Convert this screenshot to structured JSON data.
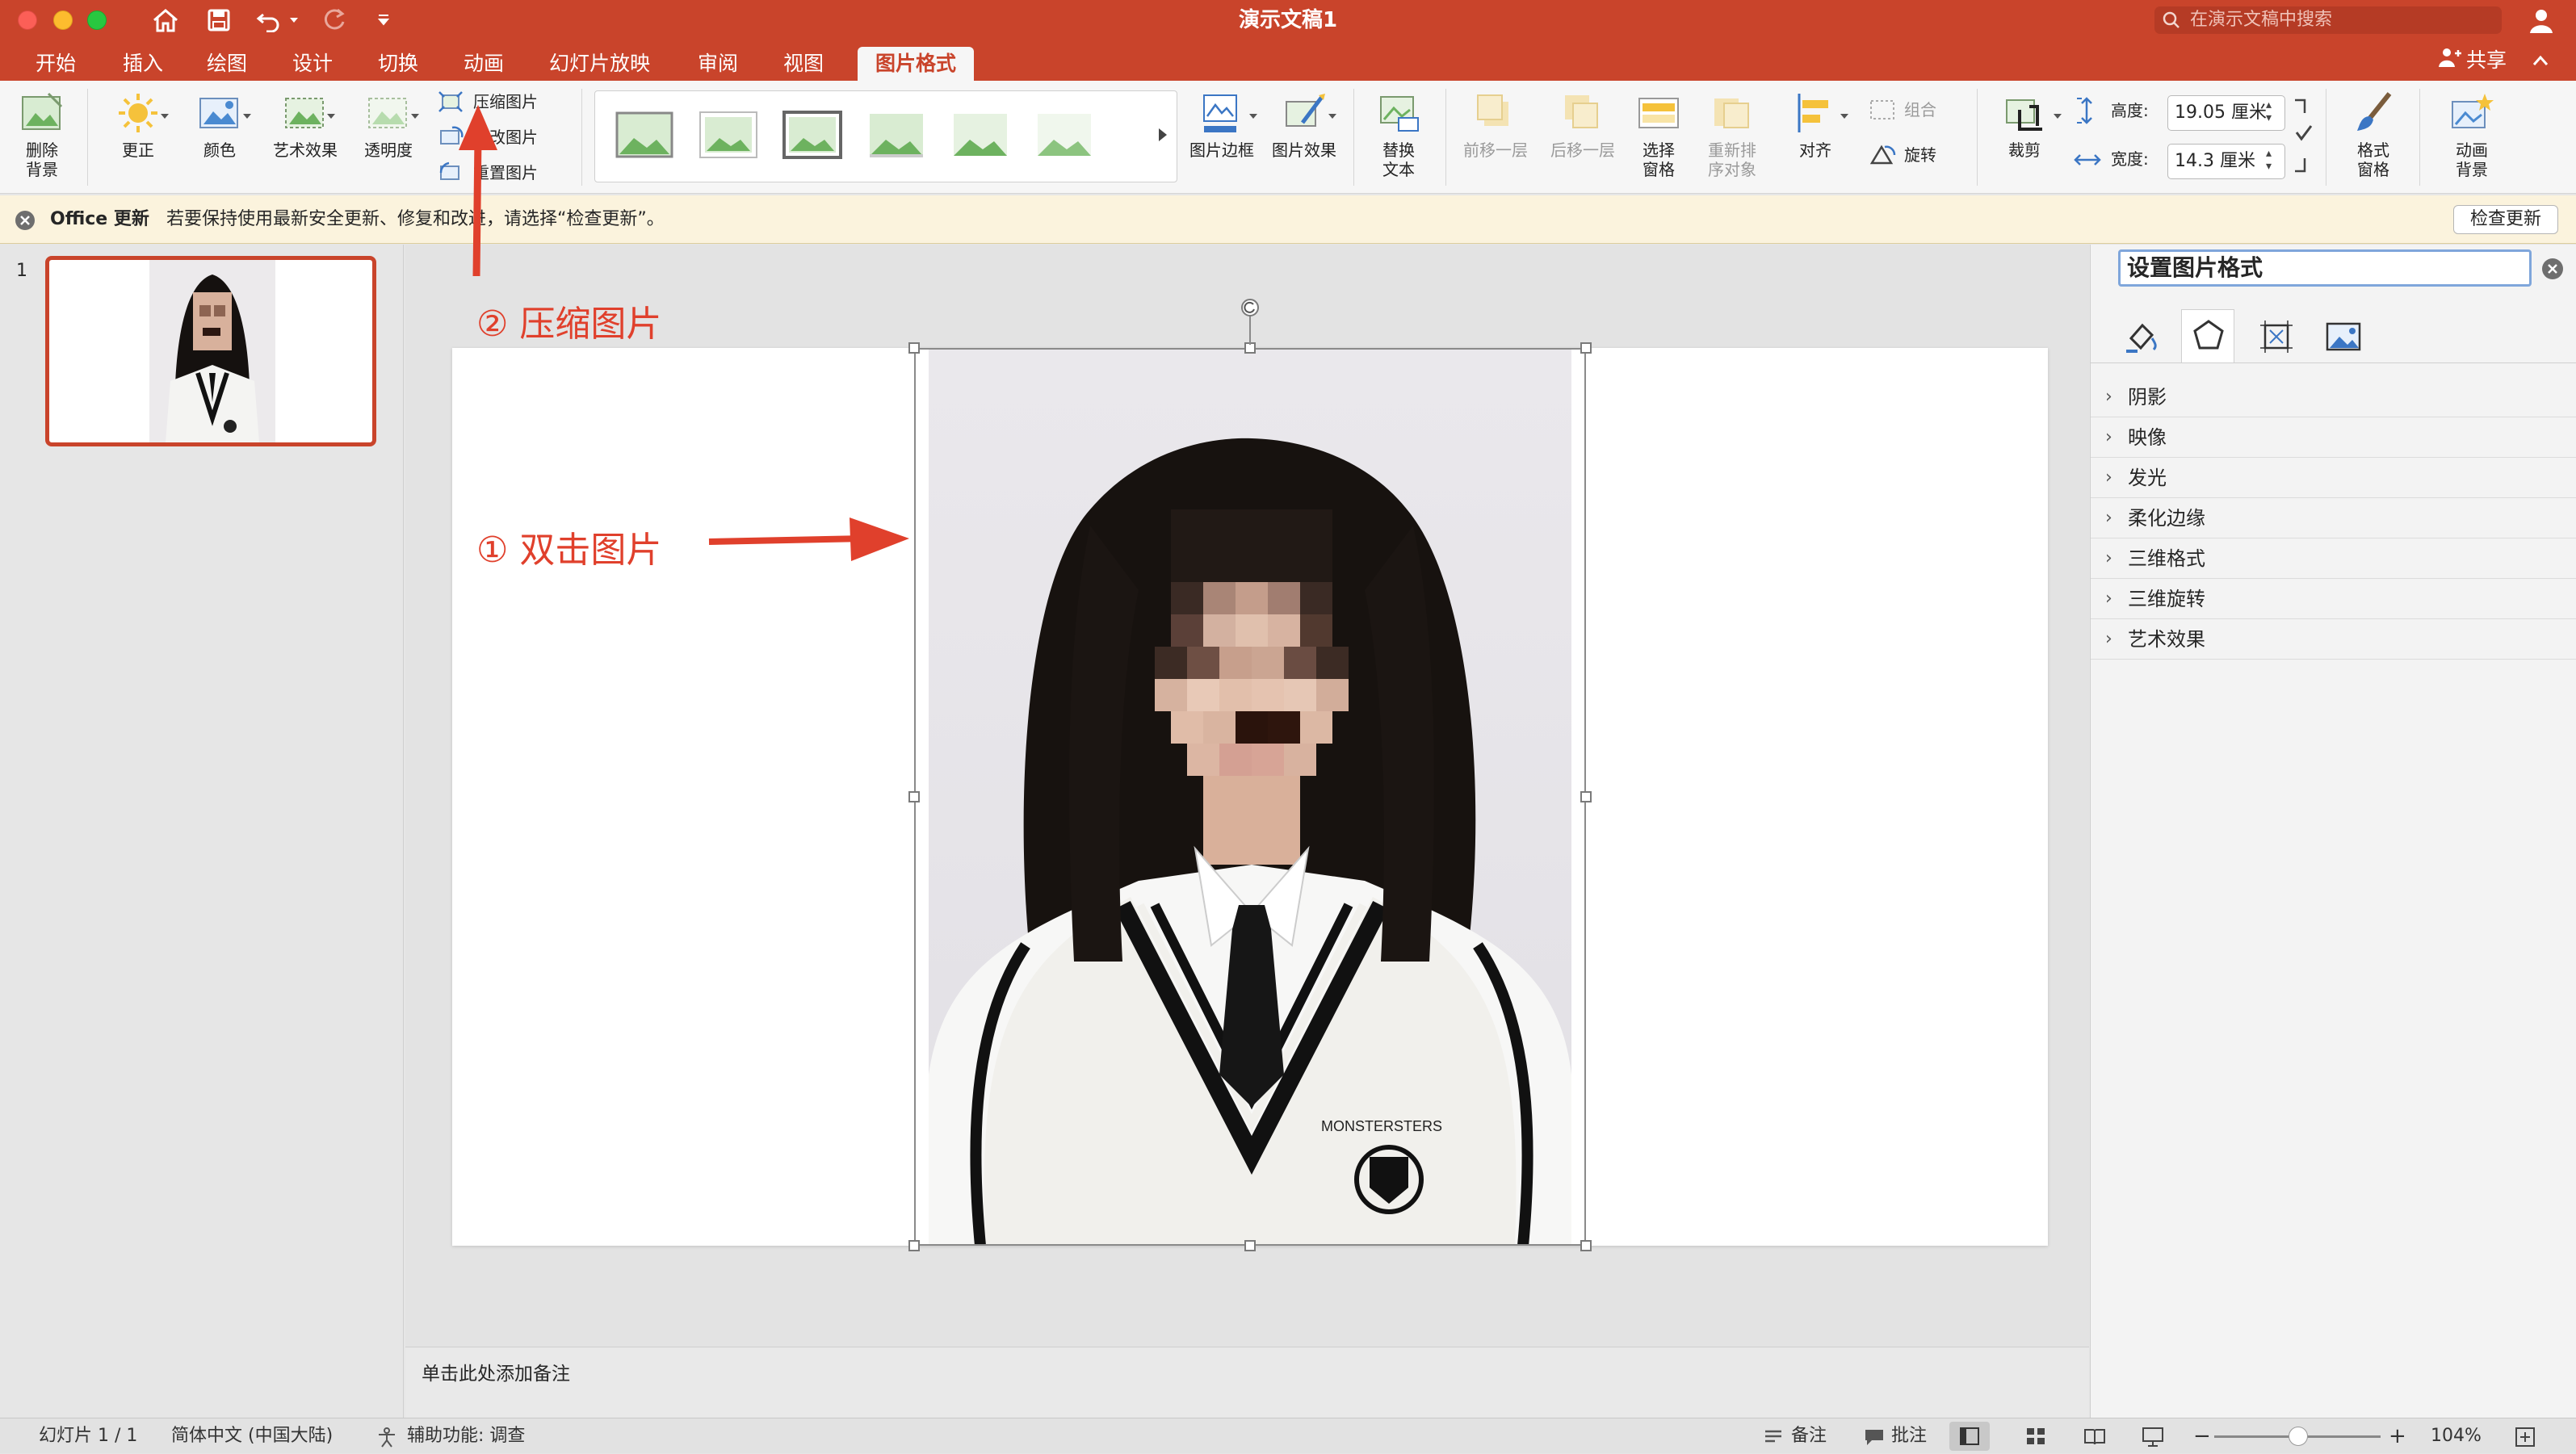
{
  "window": {
    "title": "演示文稿1",
    "search_placeholder": "在演示文稿中搜索"
  },
  "tabs": [
    "开始",
    "插入",
    "绘图",
    "设计",
    "切换",
    "动画",
    "幻灯片放映",
    "审阅",
    "视图",
    "图片格式"
  ],
  "share_label": "共享",
  "ribbon": {
    "remove_bg": [
      "删除",
      "背景"
    ],
    "corrections": "更正",
    "color": "颜色",
    "artistic": "艺术效果",
    "transparency": "透明度",
    "compress": "压缩图片",
    "change": "更改图片",
    "reset": "重置图片",
    "picture_border": "图片边框",
    "picture_effects": "图片效果",
    "alt_text": [
      "替换",
      "文本"
    ],
    "bring_forward": "前移一层",
    "send_backward": "后移一层",
    "selection_pane": [
      "选择",
      "窗格"
    ],
    "reorder": [
      "重新排",
      "序对象"
    ],
    "align": "对齐",
    "group": "组合",
    "rotate": "旋转",
    "crop": "裁剪",
    "height_label": "高度:",
    "height_value": "19.05 厘米",
    "width_label": "宽度:",
    "width_value": "14.3 厘米",
    "format_pane": [
      "格式",
      "窗格"
    ],
    "anim_bg": [
      "动画",
      "背景"
    ]
  },
  "message_bar": {
    "title": "Office 更新",
    "text": "若要保持使用最新安全更新、修复和改进，请选择“检查更新”。",
    "button": "检查更新"
  },
  "thumbnail_number": "1",
  "annotations": {
    "step1": "① 双击图片",
    "step2": "② 压缩图片"
  },
  "notes_placeholder": "单击此处添加备注",
  "format_pane": {
    "title": "设置图片格式",
    "sections": [
      "阴影",
      "映像",
      "发光",
      "柔化边缘",
      "三维格式",
      "三维旋转",
      "艺术效果"
    ]
  },
  "status": {
    "slide": "幻灯片 1 / 1",
    "language": "简体中文 (中国大陆)",
    "accessibility": "辅助功能: 调查",
    "notes": "备注",
    "comments": "批注",
    "zoom": "104%"
  },
  "colors": {
    "accent": "#c9442b",
    "annotation": "#e0402c"
  }
}
